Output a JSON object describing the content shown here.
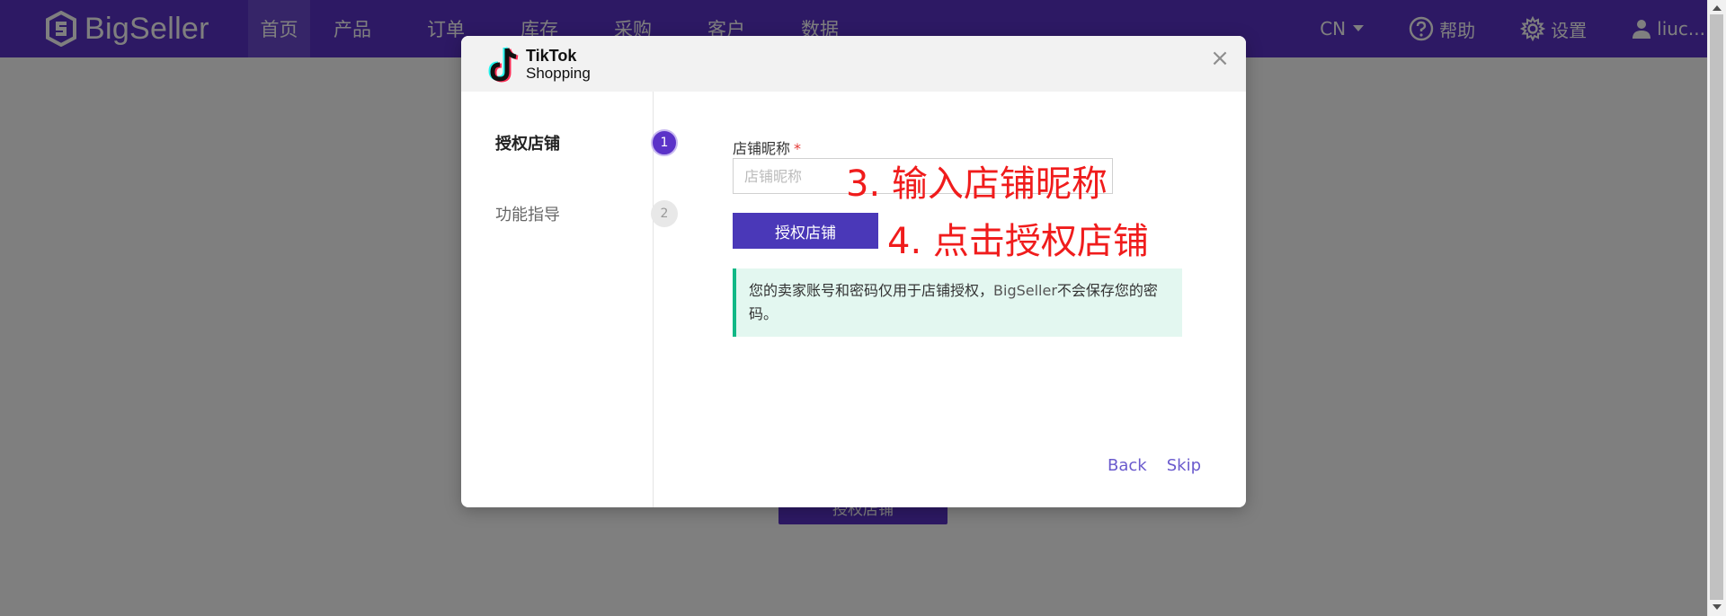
{
  "brand": {
    "name": "BigSeller"
  },
  "nav": {
    "items": [
      {
        "label": "首页",
        "active": true
      },
      {
        "label": "产品"
      },
      {
        "label": "订单"
      },
      {
        "label": "库存"
      },
      {
        "label": "采购"
      },
      {
        "label": "客户"
      },
      {
        "label": "数据"
      }
    ],
    "right": {
      "lang": "CN",
      "help": "帮助",
      "settings": "设置",
      "user": "liuc..."
    }
  },
  "background": {
    "button_label": "授权店铺"
  },
  "modal": {
    "logo": {
      "line1": "TikTok",
      "line2": "Shopping"
    },
    "close": "×",
    "steps": [
      {
        "label": "授权店铺",
        "num": "1"
      },
      {
        "label": "功能指导",
        "num": "2"
      }
    ],
    "form": {
      "label": "店铺昵称",
      "required": "*",
      "placeholder": "店铺昵称",
      "button": "授权店铺",
      "notice_pre": "您的卖家账号和密码仅用于店铺授权，",
      "notice_brand": "BigSeller",
      "notice_post": "不会保存您的密码。"
    },
    "annotations": {
      "a3": "3. 输入店铺昵称",
      "a4": "4. 点击授权店铺"
    },
    "footer": {
      "back": "Back",
      "skip": "Skip"
    }
  },
  "colors": {
    "brand": "#5b32c8",
    "button": "#4a38b8",
    "notice_bg": "#e3f7f0",
    "notice_border": "#12b886",
    "annotation": "#f01c1c"
  }
}
